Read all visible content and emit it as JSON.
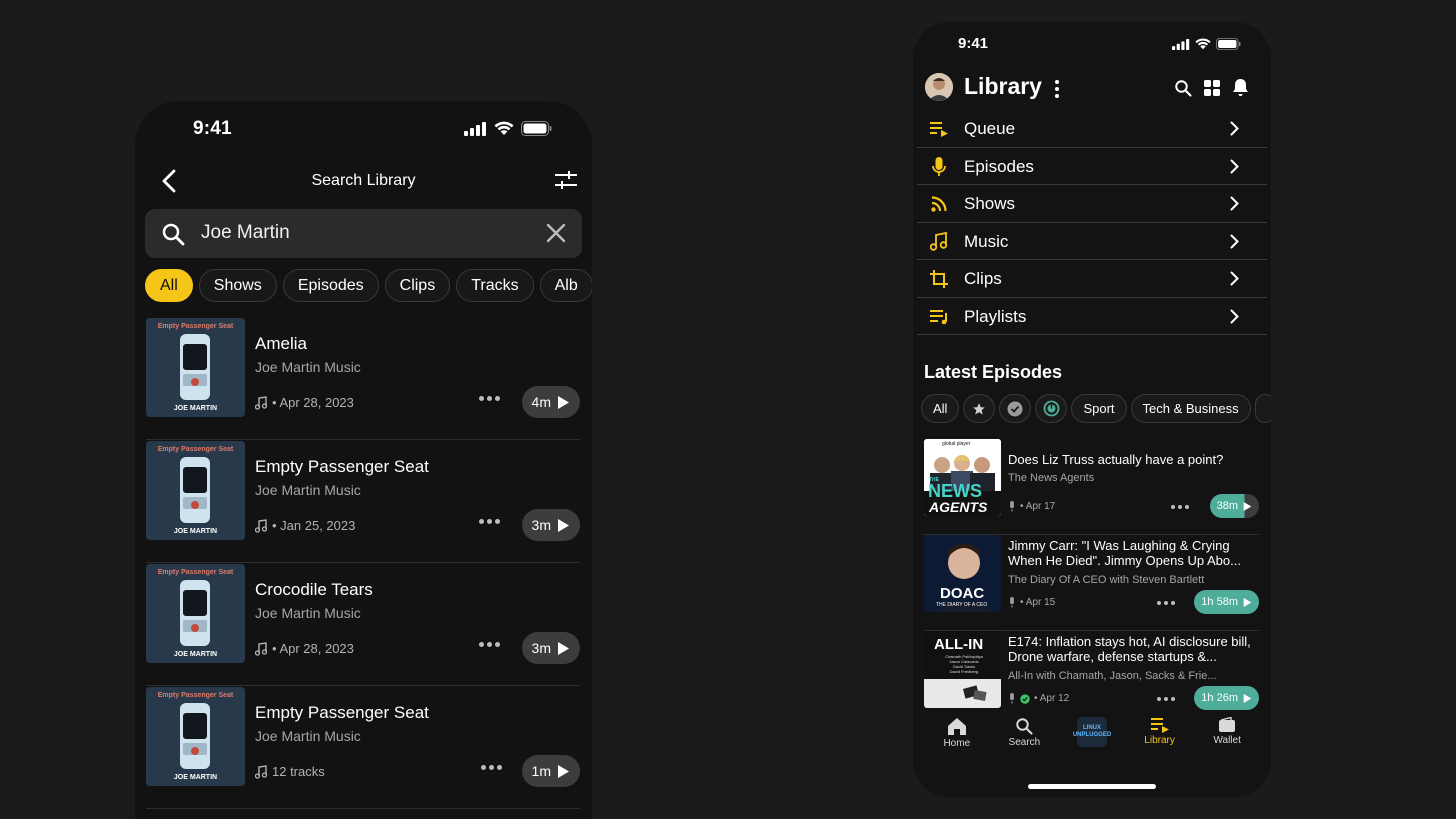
{
  "left": {
    "status": {
      "time": "9:41"
    },
    "header": {
      "title": "Search Library"
    },
    "search": {
      "value": "Joe Martin"
    },
    "filters": [
      "All",
      "Shows",
      "Episodes",
      "Clips",
      "Tracks",
      "Alb"
    ],
    "tracks": [
      {
        "title": "Amelia",
        "artist": "Joe Martin Music",
        "meta": "• Apr 28, 2023",
        "duration": "4m"
      },
      {
        "title": "Empty Passenger Seat",
        "artist": "Joe Martin Music",
        "meta": "• Jan 25, 2023",
        "duration": "3m"
      },
      {
        "title": "Crocodile Tears",
        "artist": "Joe Martin Music",
        "meta": "• Apr 28, 2023",
        "duration": "3m"
      },
      {
        "title": "Empty Passenger Seat",
        "artist": "Joe Martin Music",
        "meta": "12 tracks",
        "duration": "1m"
      }
    ],
    "cover": {
      "top_text": "Empty Passenger Seat",
      "bottom_text": "JOE MARTIN"
    }
  },
  "right": {
    "status": {
      "time": "9:41"
    },
    "header": {
      "title": "Library"
    },
    "menu": [
      {
        "label": "Queue",
        "icon": "queue-icon"
      },
      {
        "label": "Episodes",
        "icon": "microphone-icon"
      },
      {
        "label": "Shows",
        "icon": "rss-icon"
      },
      {
        "label": "Music",
        "icon": "music-note-icon"
      },
      {
        "label": "Clips",
        "icon": "crop-icon"
      },
      {
        "label": "Playlists",
        "icon": "playlist-icon"
      }
    ],
    "latest_title": "Latest Episodes",
    "episode_filters": {
      "all": "All",
      "sport": "Sport",
      "tech": "Tech & Business"
    },
    "episodes": [
      {
        "title": "Does Liz Truss actually have a point?",
        "show": "The News Agents",
        "date": "• Apr 17",
        "duration": "38m"
      },
      {
        "title": "Jimmy Carr: \"I Was Laughing & Crying When He Died\". Jimmy Opens Up Abo...",
        "show": "The Diary Of A CEO with Steven Bartlett",
        "date": "• Apr 15",
        "duration": "1h 58m"
      },
      {
        "title": "E174: Inflation stays hot, AI disclosure bill, Drone warfare, defense startups &...",
        "show": "All-In with Chamath, Jason, Sacks & Frie...",
        "date": "• Apr 12",
        "duration": "1h 26m"
      }
    ],
    "art": {
      "news_agents_top": "global player",
      "news_agents_big": "NEWS",
      "news_agents_small": "THE",
      "news_agents_bottom": "AGENTS",
      "doac_big": "DOAC",
      "doac_small": "THE DIARY OF A CEO",
      "allin_big": "ALL-IN",
      "allin_names": "Chamath Palihapitiya\nJason Calacanis\nDavid Sacks\nDavid Friedberg"
    },
    "tabs": [
      {
        "label": "Home"
      },
      {
        "label": "Search"
      },
      {
        "label": ""
      },
      {
        "label": "Library"
      },
      {
        "label": "Wallet"
      }
    ],
    "now_playing_art": "LINUX UNPLUGGED",
    "colors": {
      "accent": "#f5c518",
      "teal": "#4fae9a",
      "green": "#3ec46d"
    }
  }
}
